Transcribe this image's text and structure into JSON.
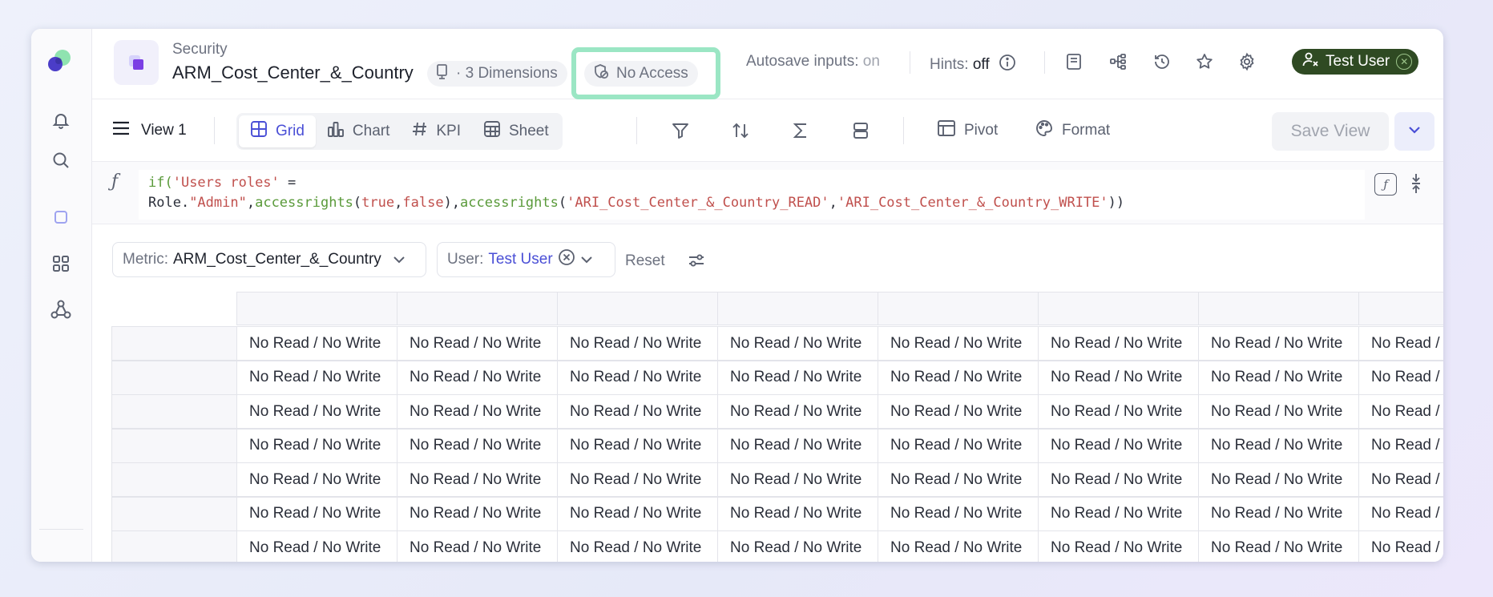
{
  "header": {
    "breadcrumb": "Security",
    "title": "ARM_Cost_Center_&_Country",
    "dimensions_chip": "· 3 Dimensions",
    "access_chip": "No Access",
    "autosave_label": "Autosave inputs:",
    "autosave_value": "on",
    "hints_label": "Hints:",
    "hints_value": "off",
    "user_badge": "Test User"
  },
  "toolbar": {
    "view_label": "View 1",
    "modes": [
      {
        "label": "Grid",
        "active": true
      },
      {
        "label": "Chart",
        "active": false
      },
      {
        "label": "KPI",
        "active": false
      },
      {
        "label": "Sheet",
        "active": false
      }
    ],
    "pivot_label": "Pivot",
    "format_label": "Format",
    "save_view_label": "Save View"
  },
  "formula": {
    "line1_a": "if(",
    "line1_b": "'Users roles'",
    "line1_c": " =",
    "line2_a": "Role.",
    "line2_b": "\"Admin\"",
    "line2_c": ",",
    "line2_d": "accessrights",
    "line2_e": "(",
    "line2_f": "true",
    "line2_g": ",",
    "line2_h": "false",
    "line2_i": "),",
    "line2_j": "accessrights",
    "line2_k": "(",
    "line2_l": "'ARI_Cost_Center_&_Country_READ'",
    "line2_m": ",",
    "line2_n": "'ARI_Cost_Center_&_Country_WRITE'",
    "line2_o": "))"
  },
  "filters": {
    "metric_label": "Metric:",
    "metric_value": "ARM_Cost_Center_&_Country",
    "user_label": "User:",
    "user_value": "Test User",
    "reset_label": "Reset"
  },
  "grid": {
    "cell_text": "No Read / No Write",
    "cell_text_cut": "No Read /",
    "rows": 7,
    "full_columns": 7
  },
  "icons": {
    "rail": [
      "bell-icon",
      "search-icon",
      "square-icon",
      "apps-icon",
      "network-icon"
    ],
    "header": [
      "document-icon",
      "hierarchy-icon",
      "history-icon",
      "star-icon",
      "gear-icon"
    ]
  }
}
